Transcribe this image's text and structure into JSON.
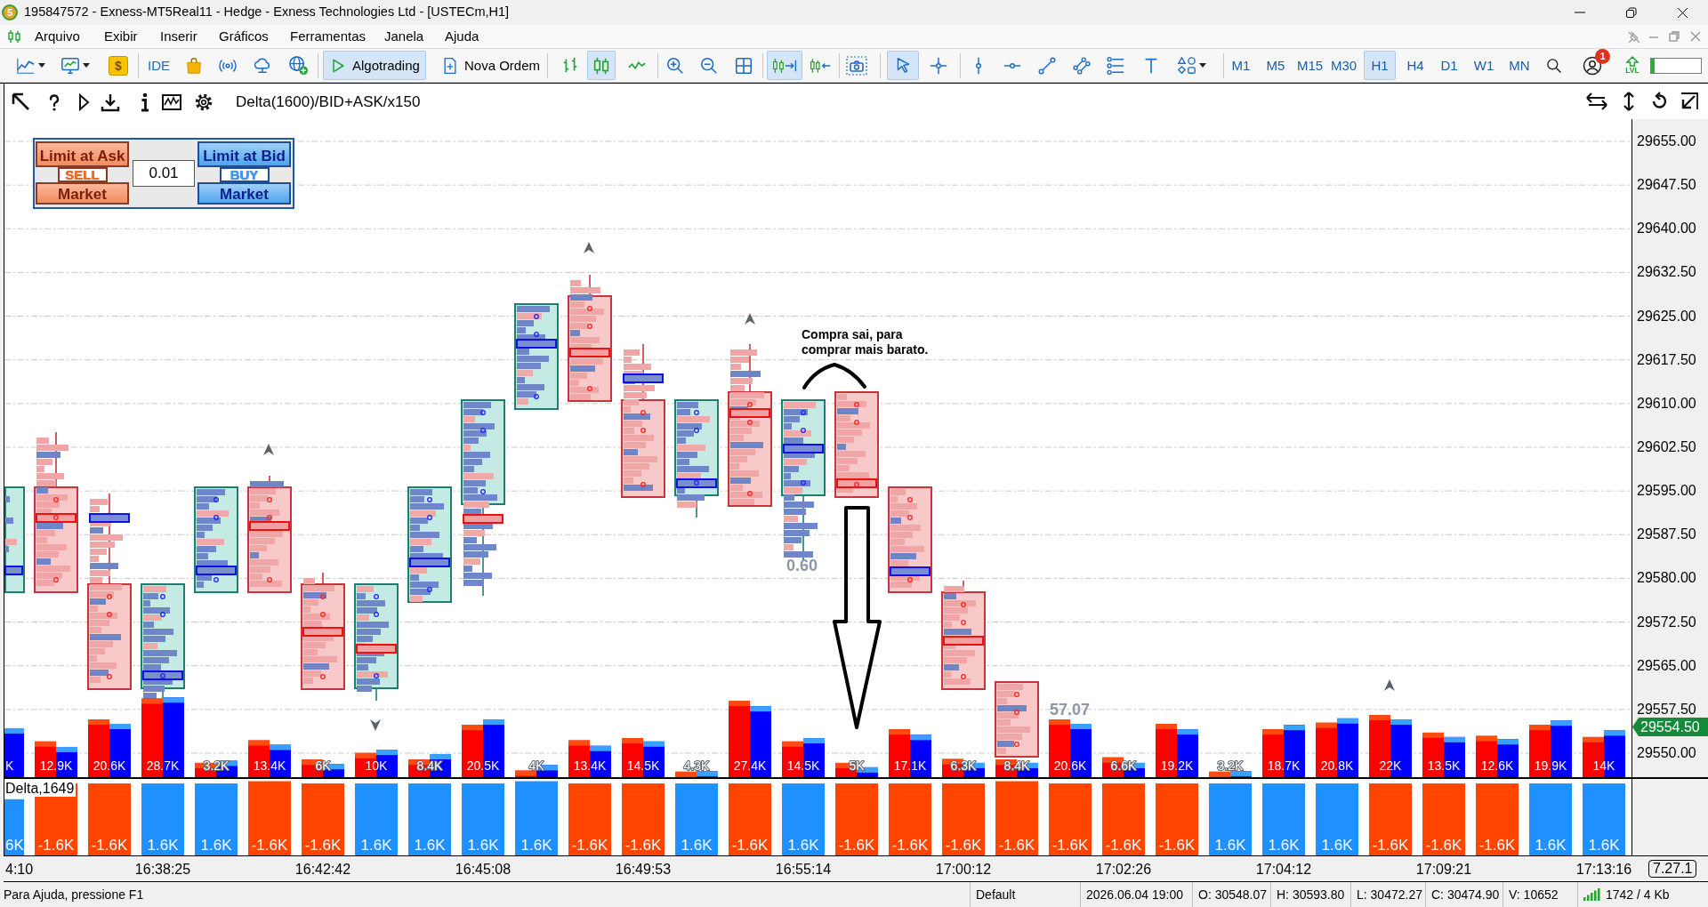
{
  "window": {
    "logo": "5",
    "title": "195847572 - Exness-MT5Real11 - Hedge - Exness Technologies Ltd - [USTECm,H1]"
  },
  "menu": [
    "Arquivo",
    "Exibir",
    "Inserir",
    "Gráficos",
    "Ferramentas",
    "Janela",
    "Ajuda"
  ],
  "toolbar": {
    "market": "$",
    "ide": "IDE",
    "algotrading": {
      "label": "Algotrading",
      "on": true
    },
    "new_order": {
      "label": "Nova Ordem"
    },
    "chart_types": [
      {
        "selected": false
      },
      {
        "selected": true
      },
      {
        "selected": false
      }
    ],
    "auto_scroll": {
      "on": true
    },
    "chart_shift": {
      "on": false
    },
    "pointer_tools": [
      {
        "selected": true
      },
      {
        "selected": false
      }
    ],
    "timeframes": [
      {
        "label": "M1",
        "selected": false
      },
      {
        "label": "M5",
        "selected": false
      },
      {
        "label": "M15",
        "selected": false
      },
      {
        "label": "M30",
        "selected": false
      },
      {
        "label": "H1",
        "selected": true
      },
      {
        "label": "H4",
        "selected": false
      },
      {
        "label": "D1",
        "selected": false
      },
      {
        "label": "W1",
        "selected": false
      },
      {
        "label": "MN",
        "selected": false
      }
    ],
    "notifications": {
      "badge": "1"
    },
    "level_button": {
      "label": "LVL"
    },
    "meter": {
      "level": 0.08
    }
  },
  "chart": {
    "title": "Delta(1600)/BID+ASK/x150",
    "trade_panel": {
      "sell": {
        "limit": "Limit at Ask",
        "action": "SELL",
        "market": "Market"
      },
      "lot": "0.01",
      "buy": {
        "limit": "Limit at Bid",
        "action": "BUY",
        "market": "Market"
      }
    },
    "candles": [
      {
        "kind": "bull"
      },
      {
        "kind": "bear"
      },
      {
        "kind": "bear"
      },
      {
        "kind": "bull"
      },
      {
        "kind": "bull"
      },
      {
        "kind": "bear"
      },
      {
        "kind": "bear"
      },
      {
        "kind": "bull"
      },
      {
        "kind": "bull"
      },
      {
        "kind": "bull"
      },
      {
        "kind": "bull"
      },
      {
        "kind": "bear"
      },
      {
        "kind": "bear"
      },
      {
        "kind": "bull"
      },
      {
        "kind": "bear"
      },
      {
        "kind": "bull"
      },
      {
        "kind": "bear"
      },
      {
        "kind": "bear"
      },
      {
        "kind": "bear"
      },
      {
        "kind": "bear"
      }
    ],
    "note": "Compra sai, para comprar mais barato.",
    "labels": [
      "0.60",
      "57.07"
    ],
    "price_axis": [
      "29655.00",
      "29647.50",
      "29640.00",
      "29632.50",
      "29625.00",
      "29617.50",
      "29610.00",
      "29602.50",
      "29595.00",
      "29587.50",
      "29580.00",
      "29572.50",
      "29565.00",
      "29557.50",
      "29550.00"
    ],
    "current_price": "29554.50",
    "volume": {
      "labels": [
        "K",
        "12.9K",
        "20.6K",
        "28.7K",
        "3.2K",
        "13.4K",
        "6K",
        "10K",
        "8.4K",
        "20.5K",
        "4K",
        "13.4K",
        "14.5K",
        "4.3K",
        "27.4K",
        "14.5K",
        "5K",
        "17.1K",
        "6.3K",
        "8.4K",
        "20.6K",
        "6.6K",
        "19.2K",
        "3.2K",
        "18.7K",
        "20.8K",
        "22K",
        "13.5K",
        "12.6K",
        "19.9K",
        "14K"
      ]
    }
  },
  "delta": {
    "title": "Delta,1649",
    "bars": [
      {
        "label": "6K",
        "color": "#1e90ff"
      },
      {
        "label": "-1.6K",
        "color": "#ff4500"
      },
      {
        "label": "-1.6K",
        "color": "#ff4500"
      },
      {
        "label": "1.6K",
        "color": "#1e90ff"
      },
      {
        "label": "1.6K",
        "color": "#1e90ff"
      },
      {
        "label": "-1.6K",
        "color": "#ff4500"
      },
      {
        "label": "-1.6K",
        "color": "#ff4500"
      },
      {
        "label": "1.6K",
        "color": "#1e90ff"
      },
      {
        "label": "1.6K",
        "color": "#1e90ff"
      },
      {
        "label": "1.6K",
        "color": "#1e90ff"
      },
      {
        "label": "1.6K",
        "color": "#1e90ff"
      },
      {
        "label": "-1.6K",
        "color": "#ff4500"
      },
      {
        "label": "-1.6K",
        "color": "#ff4500"
      },
      {
        "label": "1.6K",
        "color": "#1e90ff"
      },
      {
        "label": "-1.6K",
        "color": "#ff4500"
      },
      {
        "label": "1.6K",
        "color": "#1e90ff"
      },
      {
        "label": "-1.6K",
        "color": "#ff4500"
      },
      {
        "label": "-1.6K",
        "color": "#ff4500"
      },
      {
        "label": "-1.6K",
        "color": "#ff4500"
      },
      {
        "label": "-1.6K",
        "color": "#ff4500"
      },
      {
        "label": "-1.6K",
        "color": "#ff4500"
      },
      {
        "label": "-1.6K",
        "color": "#ff4500"
      },
      {
        "label": "-1.6K",
        "color": "#ff4500"
      },
      {
        "label": "1.6K",
        "color": "#1e90ff"
      },
      {
        "label": "1.6K",
        "color": "#1e90ff"
      },
      {
        "label": "1.6K",
        "color": "#1e90ff"
      },
      {
        "label": "-1.6K",
        "color": "#ff4500"
      },
      {
        "label": "-1.6K",
        "color": "#ff4500"
      },
      {
        "label": "-1.6K",
        "color": "#ff4500"
      },
      {
        "label": "1.6K",
        "color": "#1e90ff"
      },
      {
        "label": "1.6K",
        "color": "#1e90ff"
      }
    ]
  },
  "time_axis": [
    "4:10",
    "16:38:25",
    "16:42:42",
    "16:45:08",
    "16:49:53",
    "16:55:14",
    "17:00:12",
    "17:02:26",
    "17:04:12",
    "17:09:21",
    "17:13:16"
  ],
  "version": "7.27.1",
  "status_bar": [
    "Para Ajuda, pressione F1",
    "Default",
    "2026.06.04 19:00",
    "O: 30548.07",
    "H: 30593.80",
    "L: 30472.27",
    "C: 30474.90",
    "V: 10652",
    "1742 / 4 Kb"
  ]
}
